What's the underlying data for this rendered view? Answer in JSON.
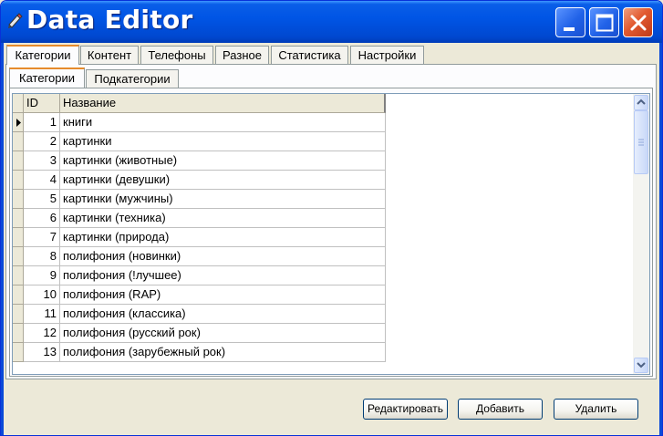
{
  "window": {
    "title": "Data Editor"
  },
  "tabs": [
    {
      "label": "Категории",
      "active": true
    },
    {
      "label": "Контент",
      "active": false
    },
    {
      "label": "Телефоны",
      "active": false
    },
    {
      "label": "Разное",
      "active": false
    },
    {
      "label": "Статистика",
      "active": false
    },
    {
      "label": "Настройки",
      "active": false
    }
  ],
  "subtabs": [
    {
      "label": "Категории",
      "active": true
    },
    {
      "label": "Подкатегории",
      "active": false
    }
  ],
  "grid": {
    "columns": [
      "ID",
      "Название"
    ],
    "rows": [
      {
        "id": "1",
        "name": "книги"
      },
      {
        "id": "2",
        "name": "картинки"
      },
      {
        "id": "3",
        "name": "картинки (животные)"
      },
      {
        "id": "4",
        "name": "картинки (девушки)"
      },
      {
        "id": "5",
        "name": "картинки (мужчины)"
      },
      {
        "id": "6",
        "name": "картинки (техника)"
      },
      {
        "id": "7",
        "name": "картинки (природа)"
      },
      {
        "id": "8",
        "name": "полифония (новинки)"
      },
      {
        "id": "9",
        "name": "полифония (!лучшее)"
      },
      {
        "id": "10",
        "name": "полифония (RAP)"
      },
      {
        "id": "11",
        "name": "полифония (классика)"
      },
      {
        "id": "12",
        "name": "полифония (русский рок)"
      },
      {
        "id": "13",
        "name": "полифония (зарубежный рок)"
      }
    ],
    "current_row": 0
  },
  "buttons": {
    "edit": "Редактировать",
    "add": "Добавить",
    "delete": "Удалить"
  },
  "colors": {
    "titlebar": "#0055e5",
    "close": "#e25a30",
    "window_bg": "#ece9d8",
    "active_tab_highlight": "#e68b2c"
  }
}
